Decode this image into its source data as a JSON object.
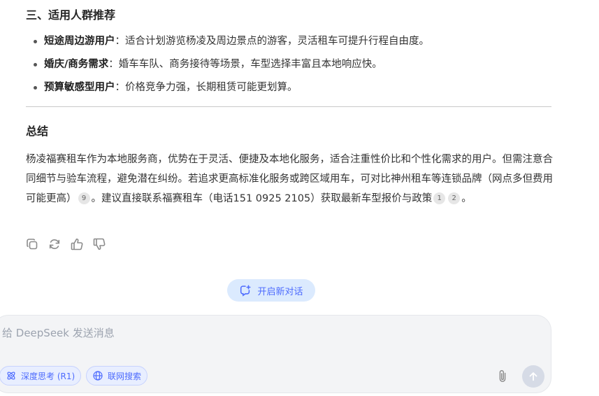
{
  "section3": {
    "heading": "三、适用人群推荐",
    "items": [
      {
        "label": "短途周边游用户",
        "text": "：适合计划游览杨凌及周边景点的游客，灵活租车可提升行程自由度。"
      },
      {
        "label": "婚庆/商务需求",
        "text": "：婚车车队、商务接待等场景，车型选择丰富且本地响应快。"
      },
      {
        "label": "预算敏感型用户",
        "text": "：价格竞争力强，长期租赁可能更划算。"
      }
    ]
  },
  "summary": {
    "title": "总结",
    "part1": "杨凌福赛租车作为本地服务商，优势在于灵活、便捷及本地化服务，适合注重性价比和个性化需求的用户。但需注意合同细节与验车流程，避免潜在纠纷。若追求更高标准化服务或跨区域用车，可对比神州租车等连锁品牌（网点多但费用可能更高）",
    "cite_a": "9",
    "part2": "。建议直接联系福赛租车（电话151 0925 2105）获取最新车型报价与政策",
    "cite_b": "1",
    "cite_c": "2",
    "part3": "。"
  },
  "actions": {
    "icons": [
      "copy-icon",
      "regenerate-icon",
      "thumbs-up-icon",
      "thumbs-down-icon"
    ]
  },
  "new_chat": {
    "label": "开启新对话"
  },
  "composer": {
    "placeholder": "给 DeepSeek 发送消息",
    "value": "",
    "deep_think_label": "深度思考 (R1)",
    "web_search_label": "联网搜索"
  },
  "colors": {
    "accent": "#4d6bfe",
    "chip_bg": "#e8eeff",
    "composer_bg": "#f3f4f6",
    "send_disabled": "#d6dbe6"
  }
}
